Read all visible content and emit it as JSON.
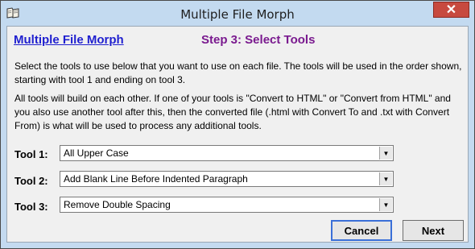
{
  "window": {
    "title": "Multiple File Morph",
    "close_glyph": "✕"
  },
  "header": {
    "app_link": "Multiple File Morph",
    "step_title": "Step 3: Select Tools"
  },
  "instructions": {
    "p1": "Select the tools to use below that you want to use on each file.  The tools will be used in the order shown, starting with tool 1 and ending on tool 3.",
    "p2": "All tools will build on each other.  If one of your tools is \"Convert to HTML\" or \"Convert from HTML\" and you also use another tool after this, then the converted file (.html with Convert To and .txt with Convert From) is what will be used to process any additional tools."
  },
  "tools": [
    {
      "label": "Tool 1:",
      "value": "All Upper Case"
    },
    {
      "label": "Tool 2:",
      "value": "Add Blank Line Before Indented Paragraph"
    },
    {
      "label": "Tool 3:",
      "value": "Remove Double Spacing"
    }
  ],
  "buttons": {
    "cancel": "Cancel",
    "next": "Next"
  },
  "icons": {
    "app": "book-icon",
    "dropdown": "chevron-down-icon",
    "close": "close-icon"
  },
  "colors": {
    "link": "#1f1fcf",
    "step_title": "#7a1a8f",
    "close_button": "#c74a3f"
  }
}
